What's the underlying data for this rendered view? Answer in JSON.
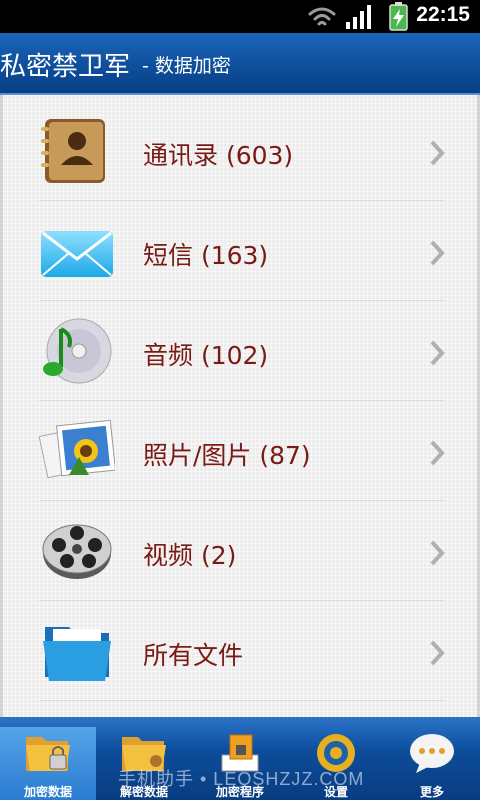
{
  "status_bar": {
    "time": "22:15"
  },
  "app": {
    "title": "私密禁卫军",
    "subtitle": "- 数据加密"
  },
  "menu": [
    {
      "label": "通讯录 (603)",
      "icon": "contacts-book-icon"
    },
    {
      "label": "短信 (163)",
      "icon": "envelope-icon"
    },
    {
      "label": "音频 (102)",
      "icon": "music-cd-icon"
    },
    {
      "label": "照片/图片 (87)",
      "icon": "photo-icon"
    },
    {
      "label": "视频 (2)",
      "icon": "film-reel-icon"
    },
    {
      "label": "所有文件",
      "icon": "folder-icon"
    }
  ],
  "tabs": [
    {
      "label": "加密数据",
      "icon": "encrypt-folder-icon",
      "active": true
    },
    {
      "label": "解密数据",
      "icon": "decrypt-folder-icon",
      "active": false
    },
    {
      "label": "加密程序",
      "icon": "encrypt-app-icon",
      "active": false
    },
    {
      "label": "设置",
      "icon": "gear-icon",
      "active": false
    },
    {
      "label": "更多",
      "icon": "more-bubble-icon",
      "active": false
    }
  ],
  "watermark": "手机助手 • LEQSHZJZ.COM",
  "colors": {
    "title_bar": "#0e4f9c",
    "label_text": "#7a1a14",
    "active_tab": "#3a8ee0"
  }
}
